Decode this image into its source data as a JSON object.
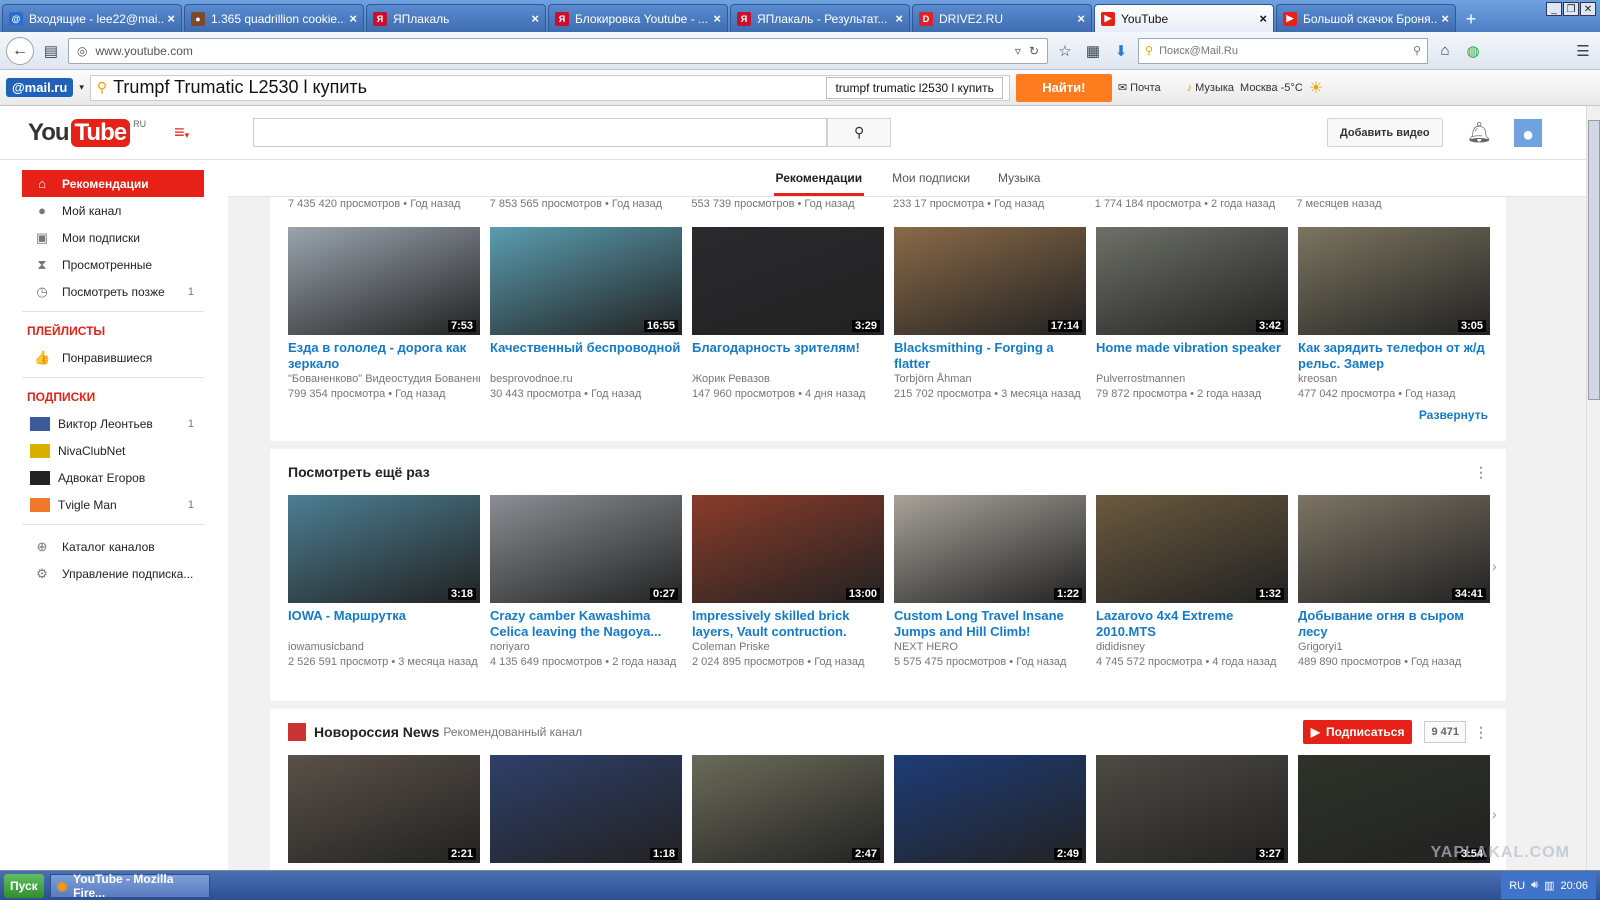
{
  "browser": {
    "tabs": [
      {
        "title": "Входящие - lee22@mai...",
        "fav_color": "#2b6cd1",
        "fav_glyph": "@"
      },
      {
        "title": "1.365 quadrillion cookie...",
        "fav_color": "#7a4a2a",
        "fav_glyph": "●"
      },
      {
        "title": "ЯПлакаль",
        "fav_color": "#c8102e",
        "fav_glyph": "Я"
      },
      {
        "title": "Блокировка Youtube - ...",
        "fav_color": "#c8102e",
        "fav_glyph": "Я"
      },
      {
        "title": "ЯПлакаль - Результат...",
        "fav_color": "#c8102e",
        "fav_glyph": "Я"
      },
      {
        "title": "DRIVE2.RU",
        "fav_color": "#d9232d",
        "fav_glyph": "D"
      },
      {
        "title": "YouTube",
        "fav_color": "#e62117",
        "fav_glyph": "▶",
        "active": true
      },
      {
        "title": "Большой скачок Броня...",
        "fav_color": "#e62117",
        "fav_glyph": "▶"
      }
    ],
    "new_tab": "+",
    "close_glyph": "×",
    "url": "www.youtube.com",
    "search_placeholder": "Поиск@Mail.Ru"
  },
  "mailbar": {
    "logo": "@mail.ru",
    "query": "Trumpf Trumatic L2530 l купить",
    "suggest": "trumpf trumatic l2530 l купить",
    "find_button": "Найти!",
    "mail_link": "Почта",
    "music_link": "Музыка",
    "weather": "Москва -5°C"
  },
  "youtube": {
    "logo_you": "You",
    "logo_tube": "Tube",
    "logo_region": "RU",
    "upload_button": "Добавить видео",
    "feed_tabs": [
      "Рекомендации",
      "Мои подписки",
      "Музыка"
    ],
    "sidebar": {
      "main": [
        {
          "label": "Рекомендации",
          "icon": "home-icon",
          "glyph": "⌂",
          "count": ""
        },
        {
          "label": "Мой канал",
          "icon": "user-icon",
          "glyph": "●",
          "count": ""
        },
        {
          "label": "Мои подписки",
          "icon": "subscriptions-icon",
          "glyph": "▣",
          "count": ""
        },
        {
          "label": "Просмотренные",
          "icon": "hourglass-icon",
          "glyph": "⧗",
          "count": ""
        },
        {
          "label": "Посмотреть позже",
          "icon": "clock-icon",
          "glyph": "◷",
          "count": "1"
        }
      ],
      "playlists_heading": "ПЛЕЙЛИСТЫ",
      "playlists": [
        {
          "label": "Понравившиеся",
          "glyph": "👍"
        }
      ],
      "subs_heading": "ПОДПИСКИ",
      "subs": [
        {
          "label": "Виктор Леонтьев",
          "count": "1",
          "color": "#3b5a9a"
        },
        {
          "label": "NivaClubNet",
          "count": "",
          "color": "#d8b000"
        },
        {
          "label": "Адвокат Егоров",
          "count": "",
          "color": "#222222"
        },
        {
          "label": "Tvigle Man",
          "count": "1",
          "color": "#f07828"
        }
      ],
      "extra": [
        {
          "label": "Каталог каналов",
          "glyph": "⊕"
        },
        {
          "label": "Управление подписка...",
          "glyph": "⚙"
        }
      ]
    },
    "partial_row_meta": [
      "7 435 420 просмотров • Год назад",
      "7 853 565 просмотров • Год назад",
      "553 739 просмотров • Год назад",
      "233 17 просмотра • Год назад",
      "1 774 184 просмотра • 2 года назад",
      "7 месяцев назад"
    ],
    "row1": [
      {
        "title": "Езда в гололед - дорога как зеркало",
        "channel": "\"Бованенково\" Видеостудия Бованенковское НГКМ",
        "views": "799 354 просмотра • Год назад",
        "dur": "7:53",
        "bg": "#9aa4ae"
      },
      {
        "title": "Качественный беспроводной",
        "channel": "besprovodnoe.ru",
        "views": "30 443 просмотра • Год назад",
        "dur": "16:55",
        "bg": "#5a9db0"
      },
      {
        "title": "Благодарность зрителям!",
        "channel": "Жорик Ревазов",
        "views": "147 960 просмотров • 4 дня назад",
        "dur": "3:29",
        "bg": "#2a2a2e"
      },
      {
        "title": "Blacksmithing - Forging a flatter",
        "channel": "Torbjörn Åhman",
        "views": "215 702 просмотра • 3 месяца назад",
        "dur": "17:14",
        "bg": "#8a6a48"
      },
      {
        "title": "Home made vibration speaker",
        "channel": "Pulverrostmannen",
        "views": "79 872 просмотра • 2 года назад",
        "dur": "3:42",
        "bg": "#6e7068"
      },
      {
        "title": "Как зарядить телефон от ж/д рельс. Замер",
        "channel": "kreosan",
        "views": "477 042 просмотра • Год назад",
        "dur": "3:05",
        "bg": "#7b7560"
      }
    ],
    "expand_link": "Развернуть",
    "shelf2_title": "Посмотреть ещё раз",
    "row2": [
      {
        "title": "IOWA - Маршрутка",
        "channel": "iowamusicband",
        "views": "2 526 591 просмотр • 3 месяца назад",
        "dur": "3:18",
        "bg": "#4c7f93"
      },
      {
        "title": "Crazy camber Kawashima Celica leaving the Nagoya...",
        "channel": "noriyaro",
        "views": "4 135 649 просмотров • 2 года назад",
        "dur": "0:27",
        "bg": "#8a8f93"
      },
      {
        "title": "Impressively skilled brick layers, Vault contruction.",
        "channel": "Coleman Priske",
        "views": "2 024 895 просмотров • Год назад",
        "dur": "13:00",
        "bg": "#8a3c2a"
      },
      {
        "title": "Custom Long Travel Insane Jumps and Hill Climb!",
        "channel": "NEXT HERO",
        "views": "5 575 475 просмотров • Год назад",
        "dur": "1:22",
        "bg": "#a7a39a"
      },
      {
        "title": "Lazarovo 4x4 Extreme 2010.MTS",
        "channel": "dididisney",
        "views": "4 745 572 просмотра • 4 года назад",
        "dur": "1:32",
        "bg": "#6b5a3e"
      },
      {
        "title": "Добывание огня в сыром лесу",
        "channel": "Grigoryi1",
        "views": "489 890 просмотров • Год назад",
        "dur": "34:41",
        "bg": "#7d7565"
      }
    ],
    "shelf3_title": "Новороссия News",
    "shelf3_sub": "Рекомендованный канал",
    "subscribe_button": "Подписаться",
    "subscribe_count": "9 471",
    "row3": [
      {
        "dur": "2:21",
        "bg": "#5a5148"
      },
      {
        "dur": "1:18",
        "bg": "#2e3f6a"
      },
      {
        "dur": "2:47",
        "bg": "#6b6b5a"
      },
      {
        "dur": "2:49",
        "bg": "#1e3c78"
      },
      {
        "dur": "3:27",
        "bg": "#4e4a44"
      },
      {
        "dur": "3:54",
        "bg": "#2e3228"
      }
    ]
  },
  "taskbar": {
    "start": "Пуск",
    "app": "YouTube - Mozilla Fire...",
    "lang": "RU",
    "time": "20:06"
  },
  "watermark": "YAPLAKAL.COM"
}
